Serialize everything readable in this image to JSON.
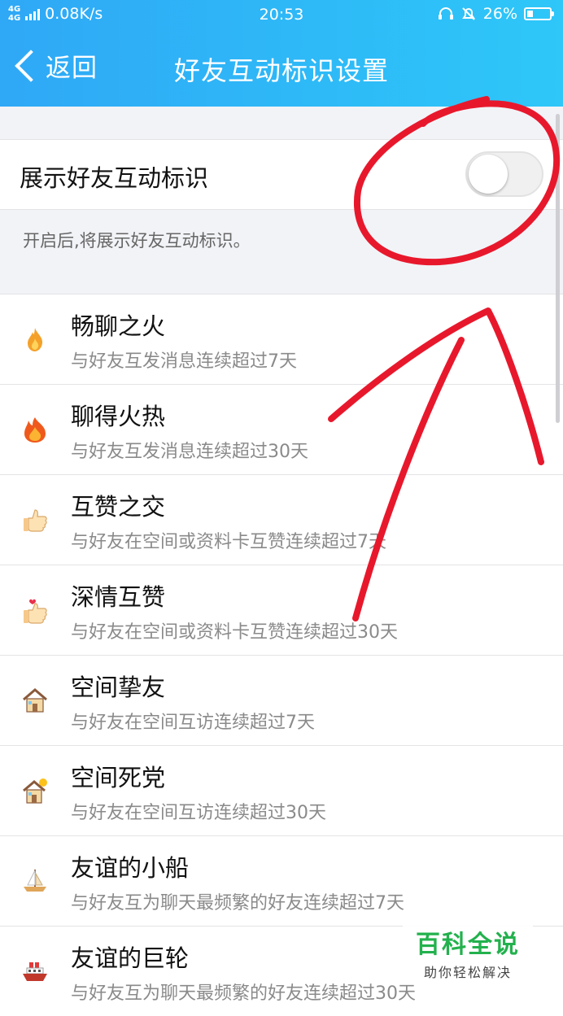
{
  "status_bar": {
    "network": "4G 4G",
    "speed": "0.08K/s",
    "time": "20:53",
    "battery_percent": "26%",
    "battery_level": 0.26
  },
  "nav": {
    "back_label": "返回",
    "title": "好友互动标识设置"
  },
  "setting": {
    "label": "展示好友互动标识",
    "enabled": false,
    "hint": "开启后,将展示好友互动标识。"
  },
  "badges": [
    {
      "icon": "small-flame-icon",
      "title": "畅聊之火",
      "desc": "与好友互发消息连续超过7天"
    },
    {
      "icon": "big-flame-icon",
      "title": "聊得火热",
      "desc": "与好友互发消息连续超过30天"
    },
    {
      "icon": "thumbs-up-icon",
      "title": "互赞之交",
      "desc": "与好友在空间或资料卡互赞连续超过7天"
    },
    {
      "icon": "thumbs-up-heart-icon",
      "title": "深情互赞",
      "desc": "与好友在空间或资料卡互赞连续超过30天"
    },
    {
      "icon": "house-icon",
      "title": "空间挚友",
      "desc": "与好友在空间互访连续超过7天"
    },
    {
      "icon": "house-sun-icon",
      "title": "空间死党",
      "desc": "与好友在空间互访连续超过30天"
    },
    {
      "icon": "sailboat-icon",
      "title": "友谊的小船",
      "desc": "与好友互为聊天最频繁的好友连续超过7天"
    },
    {
      "icon": "ship-icon",
      "title": "友谊的巨轮",
      "desc": "与好友互为聊天最频繁的好友连续超过30天"
    }
  ],
  "watermark": {
    "main": "百科全说",
    "sub": "助你轻松解决"
  },
  "colors": {
    "header_start": "#2fa8f6",
    "header_end": "#2ec7f8",
    "annotation": "#e8182c",
    "watermark": "#23b14d"
  }
}
